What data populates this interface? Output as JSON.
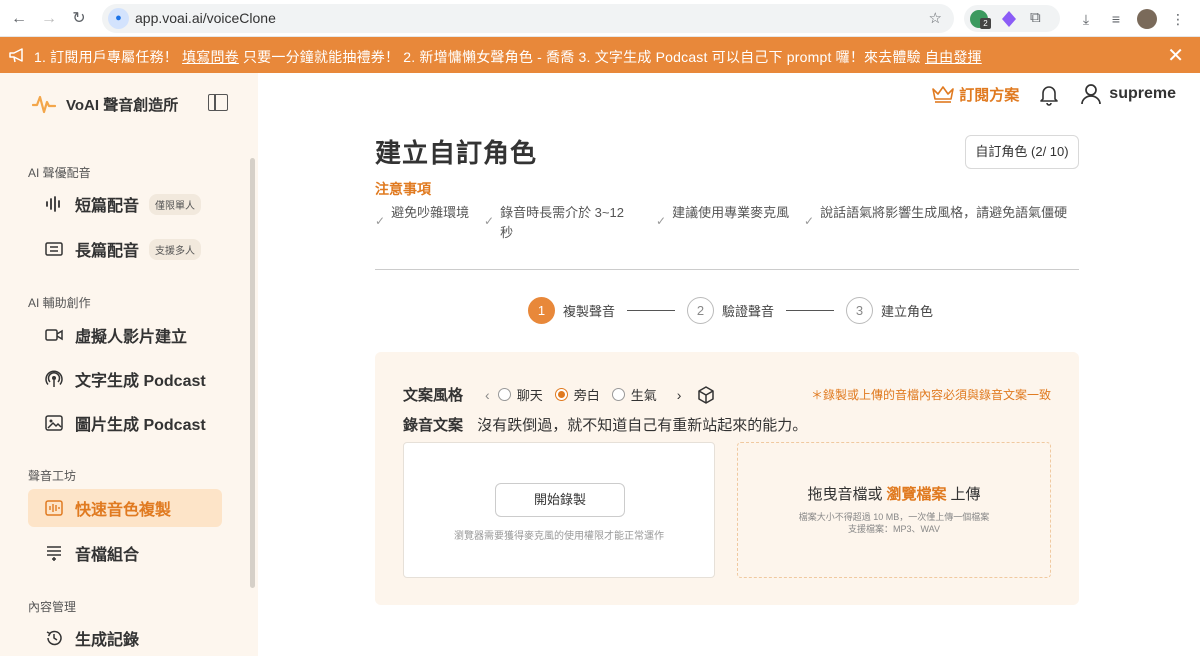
{
  "browser": {
    "url": "app.voai.ai/voiceClone",
    "ext_badge": "2"
  },
  "announcement": {
    "part1": "1. 訂閱用戶專屬任務！ ",
    "link1": "填寫問卷",
    "part2": " 只要一分鐘就能抽禮券！   2. 新增慵懶女聲角色 - 喬喬   3. 文字生成 Podcast 可以自己下 prompt 囉！來去體驗 ",
    "link2": "自由發揮"
  },
  "sidebar": {
    "brand": "VoAI 聲音創造所",
    "sections": [
      {
        "title": "AI 聲優配音"
      },
      {
        "title": "AI 輔助創作"
      },
      {
        "title": "聲音工坊"
      },
      {
        "title": "內容管理"
      }
    ],
    "items": [
      {
        "label": "短篇配音",
        "tag": "僅限單人",
        "icon": "waveform-icon"
      },
      {
        "label": "長篇配音",
        "tag": "支援多人",
        "icon": "document-icon"
      },
      {
        "label": "虛擬人影片建立",
        "icon": "video-camera-icon"
      },
      {
        "label": "文字生成 Podcast",
        "icon": "podcast-icon"
      },
      {
        "label": "圖片生成 Podcast",
        "icon": "image-icon"
      },
      {
        "label": "快速音色複製",
        "icon": "voice-clone-icon",
        "active": true
      },
      {
        "label": "音檔組合",
        "icon": "merge-icon"
      },
      {
        "label": "生成記錄",
        "icon": "history-icon"
      }
    ]
  },
  "topnav": {
    "plan": "訂閱方案",
    "user": "supreme"
  },
  "page": {
    "title": "建立自訂角色",
    "count_button": "自訂角色 (2/ 10)",
    "notice_title": "注意事項",
    "notices": [
      "避免吵雜環境",
      "錄音時長需介於 3~12 秒",
      "建議使用專業麥克風",
      "說話語氣將影響生成風格，請避免語氣僵硬"
    ]
  },
  "stepper": {
    "steps": [
      {
        "num": "1",
        "label": "複製聲音"
      },
      {
        "num": "2",
        "label": "驗證聲音"
      },
      {
        "num": "3",
        "label": "建立角色"
      }
    ]
  },
  "panel": {
    "style_label": "文案風格",
    "styles": [
      "聊天",
      "旁白",
      "生氣"
    ],
    "selected_style": "旁白",
    "warning": "＊錄製或上傳的音檔內容必須與錄音文案一致",
    "script_label": "錄音文案",
    "script_text": "沒有跌倒過，就不知道自己有重新站起來的能力。",
    "record_button": "開始錄製",
    "record_hint": "瀏覽器需要獲得麥克風的使用權限才能正常運作",
    "upload_prefix": "拖曳音檔或",
    "upload_link": "瀏覽檔案",
    "upload_suffix": "上傳",
    "upload_limit": "檔案大小不得超過 10 MB，一次僅上傳一個檔案",
    "upload_formats": "支援檔案：MP3、WAV"
  },
  "colors": {
    "accent": "#e8883a",
    "accent_text": "#e07a20",
    "sidebar_bg": "#fdf6ee",
    "panel_bg": "#fdf5ec"
  }
}
